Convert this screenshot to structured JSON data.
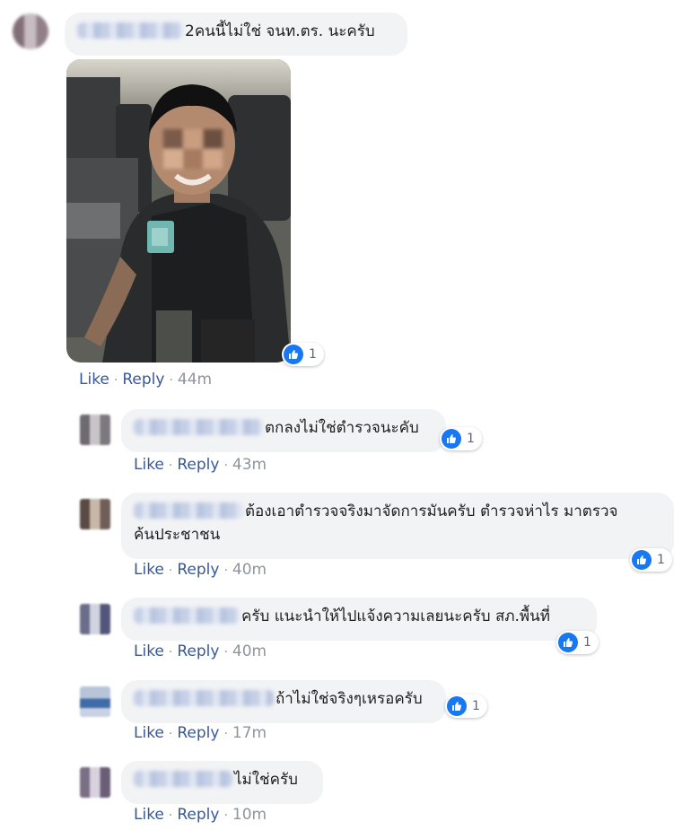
{
  "main_comment": {
    "text": "2คนนี้ไม่ใช่ จนท.ตร. นะครับ",
    "reaction_count": "1",
    "like_label": "Like",
    "reply_label": "Reply",
    "time": "44m"
  },
  "replies": [
    {
      "text": "ตกลงไม่ใช่ตำรวจนะคับ",
      "reaction_count": "1",
      "like_label": "Like",
      "reply_label": "Reply",
      "time": "43m"
    },
    {
      "text_line1": "ต้องเอาตำรวจจริงมาจัดการมันครับ ตำรวจห่าไร มาตรวจ",
      "text_line2": "ค้นประชาชน",
      "reaction_count": "1",
      "like_label": "Like",
      "reply_label": "Reply",
      "time": "40m"
    },
    {
      "text": "ครับ แนะนำให้ไปแจ้งความเลยนะครับ สภ.พื้นที่",
      "reaction_count": "1",
      "like_label": "Like",
      "reply_label": "Reply",
      "time": "40m"
    },
    {
      "text": "ถ้าไม่ใช่จริงๆเหรอครับ",
      "reaction_count": "1",
      "like_label": "Like",
      "reply_label": "Reply",
      "time": "17m"
    },
    {
      "text": "ไม่ใช่ครับ",
      "like_label": "Like",
      "reply_label": "Reply",
      "time": "10m"
    }
  ],
  "colors": {
    "link": "#385898",
    "bubble": "#f2f3f5",
    "like_blue": "#1877f2",
    "meta_gray": "#90949c"
  },
  "icons": {
    "reaction": "thumbs-up-icon"
  }
}
